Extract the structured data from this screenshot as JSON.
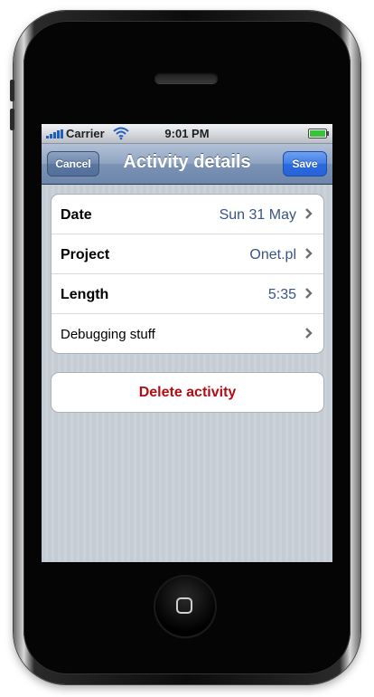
{
  "status_bar": {
    "carrier": "Carrier",
    "time": "9:01 PM",
    "signal_icon": "signal-bars-icon",
    "wifi_icon": "wifi-icon",
    "battery_icon": "battery-icon",
    "battery_level": 1.0
  },
  "nav": {
    "title": "Activity details",
    "cancel_label": "Cancel",
    "save_label": "Save"
  },
  "details": [
    {
      "label": "Date",
      "value": "Sun 31 May"
    },
    {
      "label": "Project",
      "value": "Onet.pl"
    },
    {
      "label": "Length",
      "value": "5:35"
    },
    {
      "label": "Debugging stuff",
      "value": ""
    }
  ],
  "delete_label": "Delete activity",
  "colors": {
    "accent": "#2a6ae0",
    "value_text": "#385487",
    "destructive": "#b30d12",
    "background": "#c5ccd4"
  }
}
